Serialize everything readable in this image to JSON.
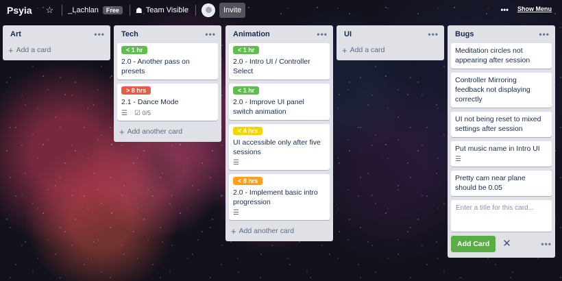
{
  "header": {
    "board_title": "Psyia",
    "team_name": "_Lachlan",
    "team_badge": "Free",
    "visibility": "Team Visible",
    "invite": "Invite",
    "show_menu": "Show Menu"
  },
  "icons": {
    "star": "star-icon",
    "visibility": "team-visibility-icon",
    "dots": "more-dots-icon"
  },
  "colors": {
    "green": "#61bd4f",
    "red": "#eb5a46",
    "yellow": "#f2d600",
    "orange": "#ff9f1a",
    "add_button": "#5aac44"
  },
  "lists": [
    {
      "name": "Art",
      "add_label": "Add a card",
      "cards": []
    },
    {
      "name": "Tech",
      "add_label": "Add another card",
      "cards": [
        {
          "label": "< 1 hr",
          "label_color": "green",
          "title": "2.0 - Another pass on presets"
        },
        {
          "label": "> 8 hrs",
          "label_color": "red",
          "title": "2.1 - Dance Mode",
          "has_desc": true,
          "checklist": "0/5"
        }
      ]
    },
    {
      "name": "Animation",
      "add_label": "Add another card",
      "cards": [
        {
          "label": "< 1 hr",
          "label_color": "green",
          "title": "2.0 - Intro UI / Controller Select"
        },
        {
          "label": "< 1 hr",
          "label_color": "green",
          "title": "2.0 - Improve UI panel switch animation"
        },
        {
          "label": "< 4 hrs",
          "label_color": "yellow",
          "title": "UI accessible only after five sessions",
          "has_desc": true
        },
        {
          "label": "< 8 hrs",
          "label_color": "orange",
          "title": "2.0 - Implement basic intro progression",
          "has_desc": true
        }
      ]
    },
    {
      "name": "UI",
      "add_label": "Add a card",
      "cards": []
    },
    {
      "name": "Bugs",
      "cards": [
        {
          "title": "Meditation circles not appearing after session"
        },
        {
          "title": "Controller Mirroring feedback not displaying correctly"
        },
        {
          "title": "UI not being reset to mixed settings after session"
        },
        {
          "title": "Put music name in Intro UI",
          "has_desc": true
        },
        {
          "title": "Pretty cam near plane should be 0.05"
        }
      ],
      "composer_placeholder": "Enter a title for this card...",
      "composer_button": "Add Card"
    }
  ]
}
